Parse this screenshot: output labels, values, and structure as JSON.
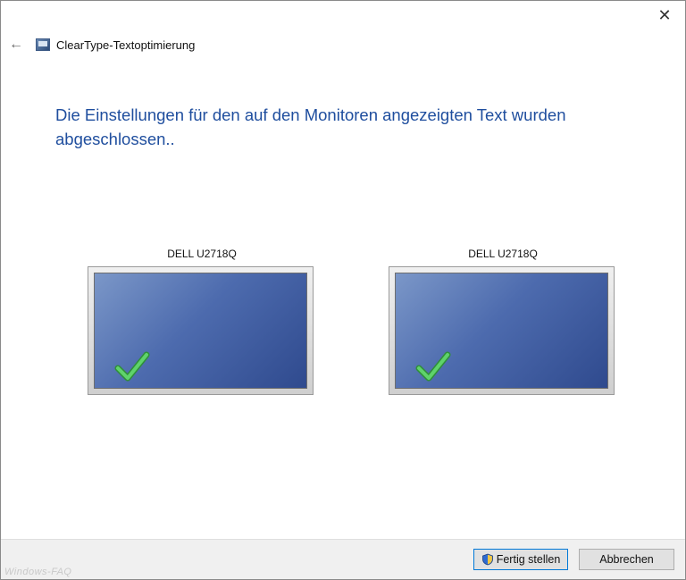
{
  "window": {
    "title": "ClearType-Textoptimierung",
    "close_symbol": "✕",
    "back_symbol": "←"
  },
  "main": {
    "heading": "Die Einstellungen für den auf den Monitoren angezeigten Text wurden abgeschlossen.."
  },
  "monitors": [
    {
      "label": "DELL U2718Q",
      "status_icon": "checkmark-icon"
    },
    {
      "label": "DELL U2718Q",
      "status_icon": "checkmark-icon"
    }
  ],
  "footer": {
    "finish_label": "Fertig stellen",
    "cancel_label": "Abbrechen",
    "watermark": "Windows-FAQ"
  },
  "colors": {
    "heading": "#1f4e9e",
    "screen": "#3f5ca0",
    "check": "#3cb94a"
  }
}
